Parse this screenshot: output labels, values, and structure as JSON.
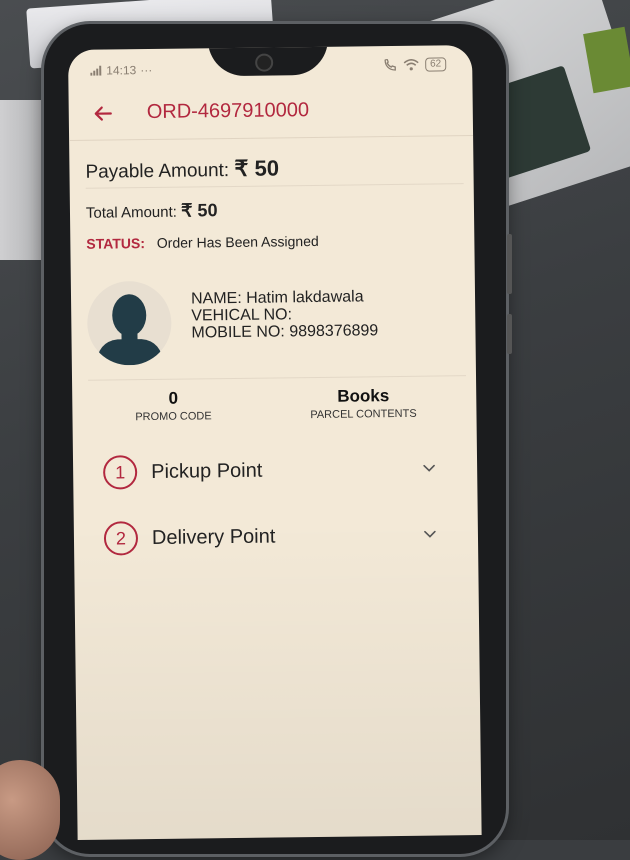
{
  "status_bar": {
    "time": "14:13",
    "dots": "···",
    "battery": "62"
  },
  "header": {
    "order_id": "ORD-4697910000"
  },
  "amounts": {
    "payable_label": "Payable Amount:",
    "payable_value": "₹ 50",
    "total_label": "Total Amount:",
    "total_value": "₹ 50"
  },
  "status": {
    "label": "STATUS:",
    "text": "Order Has Been Assigned"
  },
  "driver": {
    "name_label": "NAME:",
    "name": "Hatim  lakdawala",
    "vehicle_label": "VEHICAL NO:",
    "vehicle": "",
    "mobile_label": "MOBILE NO:",
    "mobile": "9898376899"
  },
  "stats": {
    "promo_value": "0",
    "promo_label": "PROMO CODE",
    "parcel_value": "Books",
    "parcel_label": "PARCEL CONTENTS"
  },
  "points": [
    {
      "num": "1",
      "label": "Pickup Point"
    },
    {
      "num": "2",
      "label": "Delivery Point"
    }
  ],
  "colors": {
    "accent": "#b2283f",
    "screen_bg": "#f3e9d7"
  }
}
